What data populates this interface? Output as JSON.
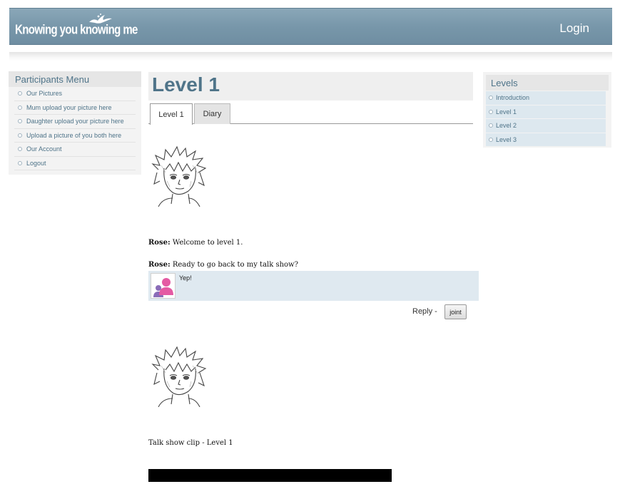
{
  "header": {
    "logo_text": "Knowing you knowing me",
    "login_label": "Login"
  },
  "participants_menu": {
    "title": "Participants Menu",
    "items": [
      {
        "label": "Our Pictures"
      },
      {
        "label": "Mum upload your picture here"
      },
      {
        "label": "Daughter upload your picture here"
      },
      {
        "label": "Upload a picture of you both here"
      },
      {
        "label": "Our Account"
      },
      {
        "label": "Logout"
      }
    ]
  },
  "levels_menu": {
    "title": "Levels",
    "items": [
      {
        "label": "Introduction"
      },
      {
        "label": "Level 1"
      },
      {
        "label": "Level 2"
      },
      {
        "label": "Level 3"
      }
    ]
  },
  "main": {
    "title": "Level 1",
    "tabs": [
      {
        "label": "Level 1",
        "active": true
      },
      {
        "label": "Diary",
        "active": false
      }
    ],
    "messages": [
      {
        "speaker": "Rose:",
        "text": "Welcome to level 1."
      },
      {
        "speaker": "Rose:",
        "text": "Ready to go back to my talk show?"
      }
    ],
    "reply": {
      "text": "Yep!",
      "reply_label": "Reply -",
      "joint_label": "joint"
    },
    "clip_caption": "Talk show clip - Level 1"
  },
  "colors": {
    "header_bar": "#7897aa",
    "accent_text": "#4f7489",
    "reply_bg": "#dfe9f0"
  }
}
